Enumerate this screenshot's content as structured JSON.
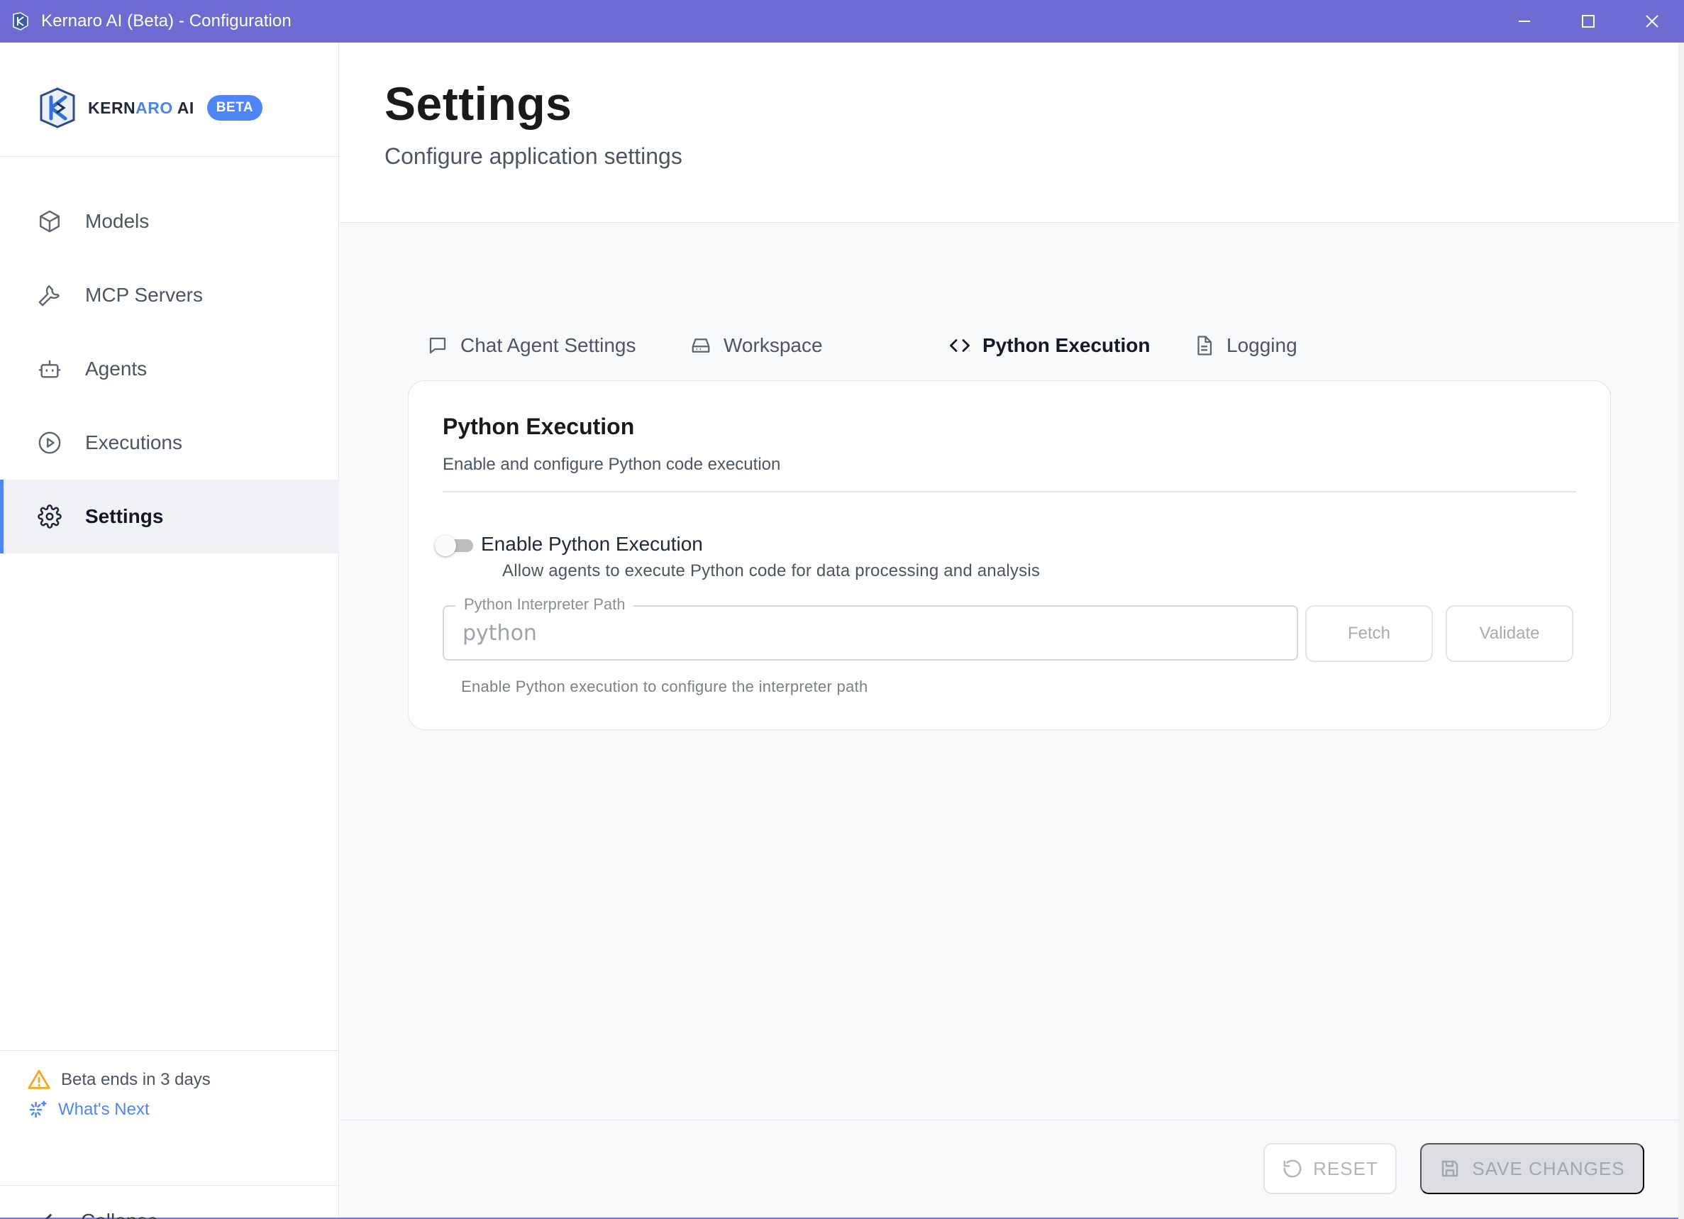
{
  "window": {
    "title": "Kernaro AI (Beta) - Configuration",
    "icon": "kernaro-app-icon",
    "controls": [
      "minimize-icon",
      "maximize-icon",
      "close-icon"
    ]
  },
  "brand": {
    "name_prefix": "KERN",
    "name_accent": "ARO",
    "name_suffix": "AI",
    "badge": "BETA"
  },
  "sidebar": {
    "items": [
      {
        "label": "Models",
        "icon": "cube-icon",
        "active": false
      },
      {
        "label": "MCP Servers",
        "icon": "wrench-icon",
        "active": false
      },
      {
        "label": "Agents",
        "icon": "robot-icon",
        "active": false
      },
      {
        "label": "Executions",
        "icon": "play-circle-icon",
        "active": false
      },
      {
        "label": "Settings",
        "icon": "gear-icon",
        "active": true
      }
    ],
    "beta_note": "Beta ends in 3 days",
    "whats_next": "What's Next",
    "collapse": "Collapse"
  },
  "header": {
    "title": "Settings",
    "subtitle": "Configure application settings"
  },
  "tabs": [
    {
      "label": "Chat Agent Settings",
      "icon": "chat-bubble-icon",
      "active": false
    },
    {
      "label": "Workspace",
      "icon": "drive-icon",
      "active": false
    },
    {
      "label": "Python Execution",
      "icon": "code-icon",
      "active": true
    },
    {
      "label": "Logging",
      "icon": "document-icon",
      "active": false
    }
  ],
  "python_card": {
    "title": "Python Execution",
    "description": "Enable and configure Python code execution",
    "toggle_label": "Enable Python Execution",
    "toggle_help": "Allow agents to execute Python code for data processing and analysis",
    "toggle_on": false,
    "interpreter_label": "Python Interpreter Path",
    "interpreter_value": "python",
    "interpreter_helper": "Enable Python execution to configure the interpreter path",
    "fetch_label": "Fetch",
    "validate_label": "Validate"
  },
  "footer": {
    "reset_label": "RESET",
    "save_label": "SAVE CHANGES"
  },
  "colors": {
    "titlebar": "#6e6bd3",
    "accent": "#4f86f7",
    "warning": "#f5a623"
  }
}
